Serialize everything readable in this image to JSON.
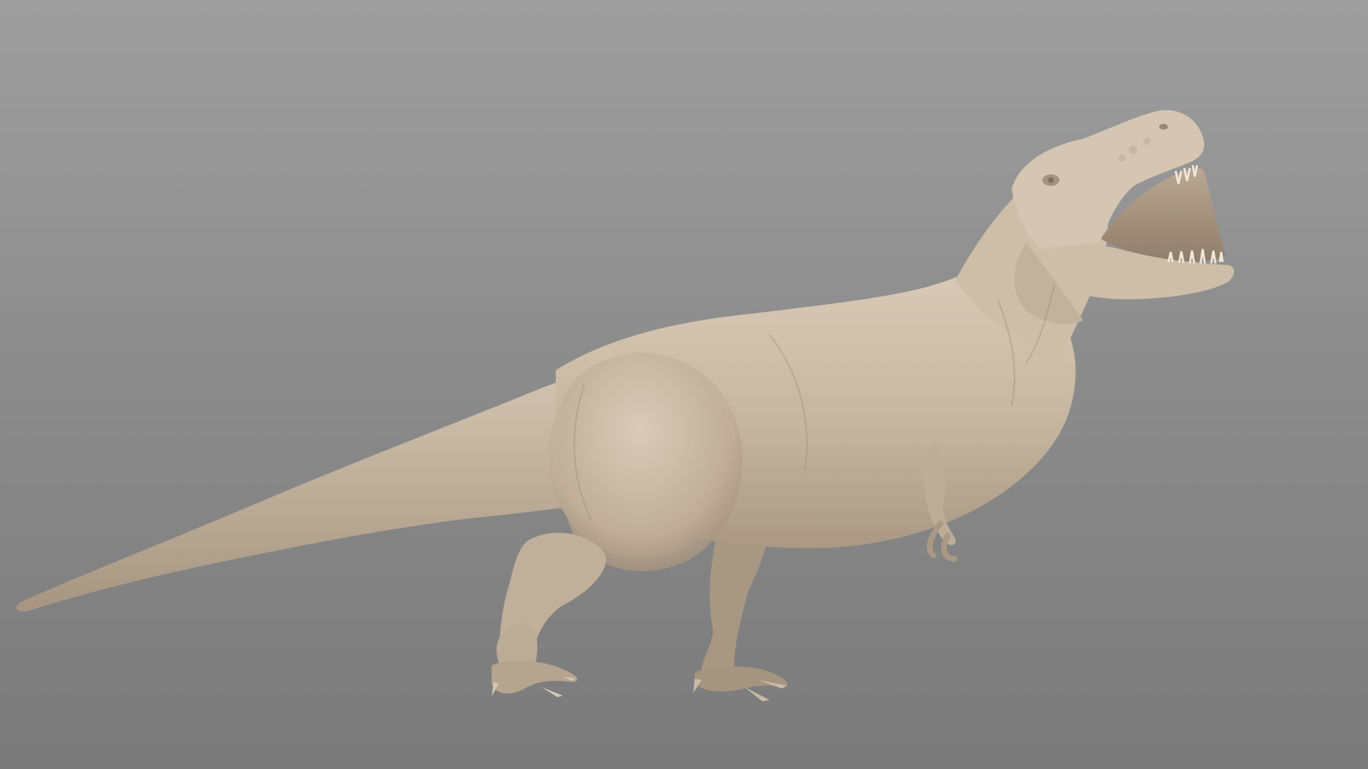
{
  "scene": {
    "subject": "tyrannosaurus-sculpt",
    "background_top": "#9e9e9e",
    "background_bottom": "#7a7a7a",
    "material_color": "#cbbca8",
    "shadow_color": "#8f806d"
  }
}
